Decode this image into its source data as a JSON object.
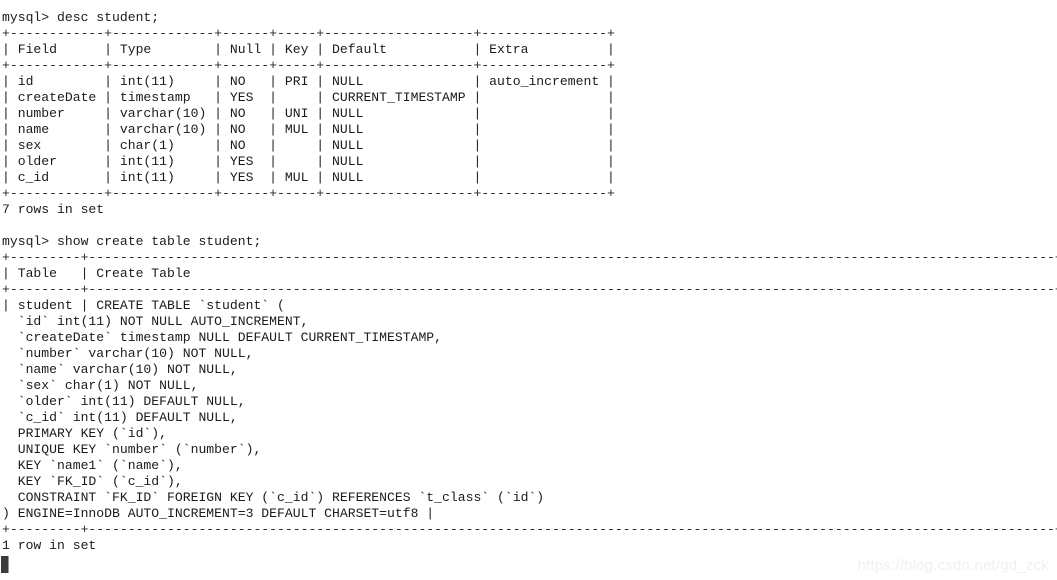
{
  "terminal": {
    "background_color": "#ffffff",
    "text_color": "#1b1b1b",
    "prompt": "mysql>",
    "cursor": {
      "name": "text-cursor",
      "color": "#3b3b3b"
    }
  },
  "watermark": {
    "text": "https://blog.csdn.net/gd_zck",
    "color": "#f0f0f0"
  },
  "commands": [
    {
      "id": "desc-student",
      "text": "mysql> desc student;"
    },
    {
      "id": "show-create-table-student",
      "text": "mysql> show create table student;"
    }
  ],
  "desc_result": {
    "columns": [
      "Field",
      "Type",
      "Null",
      "Key",
      "Default",
      "Extra"
    ],
    "rows": [
      [
        "id",
        "int(11)",
        "NO",
        "PRI",
        "NULL",
        "auto_increment"
      ],
      [
        "createDate",
        "timestamp",
        "YES",
        "",
        "CURRENT_TIMESTAMP",
        ""
      ],
      [
        "number",
        "varchar(10)",
        "NO",
        "UNI",
        "NULL",
        ""
      ],
      [
        "name",
        "varchar(10)",
        "NO",
        "MUL",
        "NULL",
        ""
      ],
      [
        "sex",
        "char(1)",
        "NO",
        "",
        "NULL",
        ""
      ],
      [
        "older",
        "int(11)",
        "YES",
        "",
        "NULL",
        ""
      ],
      [
        "c_id",
        "int(11)",
        "YES",
        "MUL",
        "NULL",
        ""
      ]
    ],
    "footer": "7 rows in set"
  },
  "show_create_result": {
    "columns": [
      "Table",
      "Create Table"
    ],
    "table_name": "student",
    "create_statement_lines": [
      "CREATE TABLE `student` (",
      "  `id` int(11) NOT NULL AUTO_INCREMENT,",
      "  `createDate` timestamp NULL DEFAULT CURRENT_TIMESTAMP,",
      "  `number` varchar(10) NOT NULL,",
      "  `name` varchar(10) NOT NULL,",
      "  `sex` char(1) NOT NULL,",
      "  `older` int(11) DEFAULT NULL,",
      "  `c_id` int(11) DEFAULT NULL,",
      "  PRIMARY KEY (`id`),",
      "  UNIQUE KEY `number` (`number`),",
      "  KEY `name1` (`name`),",
      "  KEY `FK_ID` (`c_id`),",
      "  CONSTRAINT `FK_ID` FOREIGN KEY (`c_id`) REFERENCES `t_class` (`id`)",
      ") ENGINE=InnoDB AUTO_INCREMENT=3 DEFAULT CHARSET=utf8"
    ],
    "footer": "1 row in set"
  },
  "rendered_lines": [
    {
      "name": "command-desc-student",
      "text": "mysql> desc student;",
      "kind": "command"
    },
    {
      "name": "desc-table-top-rule",
      "text": "+------------+-------------+------+-----+-------------------+----------------+",
      "kind": "rule"
    },
    {
      "name": "desc-table-header-row",
      "text": "| Field      | Type        | Null | Key | Default           | Extra          |",
      "kind": "text"
    },
    {
      "name": "desc-table-header-rule",
      "text": "+------------+-------------+------+-----+-------------------+----------------+",
      "kind": "rule"
    },
    {
      "name": "desc-table-row-id",
      "text": "| id         | int(11)     | NO   | PRI | NULL              | auto_increment |",
      "kind": "text"
    },
    {
      "name": "desc-table-row-createDate",
      "text": "| createDate | timestamp   | YES  |     | CURRENT_TIMESTAMP |                |",
      "kind": "text"
    },
    {
      "name": "desc-table-row-number",
      "text": "| number     | varchar(10) | NO   | UNI | NULL              |                |",
      "kind": "text"
    },
    {
      "name": "desc-table-row-name",
      "text": "| name       | varchar(10) | NO   | MUL | NULL              |                |",
      "kind": "text"
    },
    {
      "name": "desc-table-row-sex",
      "text": "| sex        | char(1)     | NO   |     | NULL              |                |",
      "kind": "text"
    },
    {
      "name": "desc-table-row-older",
      "text": "| older      | int(11)     | YES  |     | NULL              |                |",
      "kind": "text"
    },
    {
      "name": "desc-table-row-c_id",
      "text": "| c_id       | int(11)     | YES  | MUL | NULL              |                |",
      "kind": "text"
    },
    {
      "name": "desc-table-bottom-rule",
      "text": "+------------+-------------+------+-----+-------------------+----------------+",
      "kind": "rule"
    },
    {
      "name": "desc-result-footer",
      "text": "7 rows in set",
      "kind": "text"
    },
    {
      "name": "spacer-line-1",
      "text": " ",
      "kind": "blank"
    },
    {
      "name": "command-show-create-table",
      "text": "mysql> show create table student;",
      "kind": "command"
    },
    {
      "name": "create-table-top-rule",
      "text": "+---------+---------------------------------------------------------------------------------------------------------------------------+",
      "kind": "rule"
    },
    {
      "name": "create-table-header-row",
      "text": "| Table   | Create Table",
      "kind": "text"
    },
    {
      "name": "create-table-header-rule",
      "text": "+---------+---------------------------------------------------------------------------------------------------------------------------+",
      "kind": "rule"
    },
    {
      "name": "create-table-body-line-1",
      "text": "| student | CREATE TABLE `student` (",
      "kind": "text"
    },
    {
      "name": "create-table-body-line-2",
      "text": "  `id` int(11) NOT NULL AUTO_INCREMENT,",
      "kind": "text"
    },
    {
      "name": "create-table-body-line-3",
      "text": "  `createDate` timestamp NULL DEFAULT CURRENT_TIMESTAMP,",
      "kind": "text"
    },
    {
      "name": "create-table-body-line-4",
      "text": "  `number` varchar(10) NOT NULL,",
      "kind": "text"
    },
    {
      "name": "create-table-body-line-5",
      "text": "  `name` varchar(10) NOT NULL,",
      "kind": "text"
    },
    {
      "name": "create-table-body-line-6",
      "text": "  `sex` char(1) NOT NULL,",
      "kind": "text"
    },
    {
      "name": "create-table-body-line-7",
      "text": "  `older` int(11) DEFAULT NULL,",
      "kind": "text"
    },
    {
      "name": "create-table-body-line-8",
      "text": "  `c_id` int(11) DEFAULT NULL,",
      "kind": "text"
    },
    {
      "name": "create-table-body-line-9",
      "text": "  PRIMARY KEY (`id`),",
      "kind": "text"
    },
    {
      "name": "create-table-body-line-10",
      "text": "  UNIQUE KEY `number` (`number`),",
      "kind": "text"
    },
    {
      "name": "create-table-body-line-11",
      "text": "  KEY `name1` (`name`),",
      "kind": "text"
    },
    {
      "name": "create-table-body-line-12",
      "text": "  KEY `FK_ID` (`c_id`),",
      "kind": "text"
    },
    {
      "name": "create-table-body-line-13",
      "text": "  CONSTRAINT `FK_ID` FOREIGN KEY (`c_id`) REFERENCES `t_class` (`id`)",
      "kind": "text"
    },
    {
      "name": "create-table-body-line-14",
      "text": ") ENGINE=InnoDB AUTO_INCREMENT=3 DEFAULT CHARSET=utf8 |",
      "kind": "text"
    },
    {
      "name": "create-table-bottom-rule",
      "text": "+---------+---------------------------------------------------------------------------------------------------------------------------+",
      "kind": "rule"
    },
    {
      "name": "create-result-footer",
      "text": "1 row in set",
      "kind": "text"
    }
  ]
}
